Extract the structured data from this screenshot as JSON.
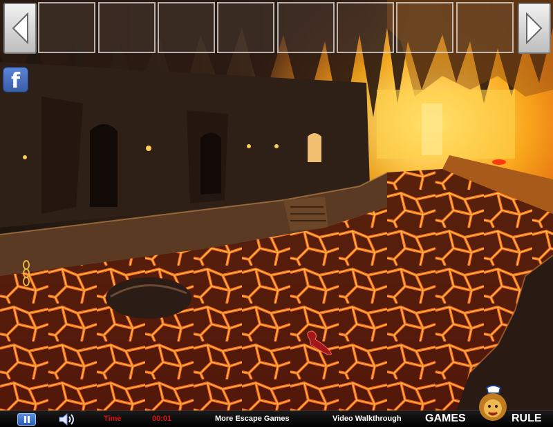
{
  "inventory": {
    "prev_icon": "arrow-left-icon",
    "next_icon": "arrow-right-icon",
    "slots": [
      "",
      "",
      "",
      "",
      "",
      "",
      "",
      "",
      ""
    ]
  },
  "social": {
    "facebook_label": "f",
    "icon": "facebook-icon"
  },
  "footer": {
    "pause_icon": "pause-icon",
    "sound_icon": "speaker-icon",
    "time_label": "Time",
    "time_value": "00:01",
    "more_games": "More Escape Games",
    "walkthrough": "Video Walkthrough",
    "brand_left": "GAMES",
    "brand_right": "RULE"
  },
  "scene": {
    "items": [
      {
        "name": "golden-chain",
        "icon": "chain-icon"
      },
      {
        "name": "red-scorpion",
        "icon": "scorpion-icon"
      }
    ]
  },
  "colors": {
    "lava": "#e8400c",
    "lava_glow": "#ffb347",
    "rock": "#3a2418",
    "time_red": "#e01010",
    "facebook": "#3b5998"
  }
}
